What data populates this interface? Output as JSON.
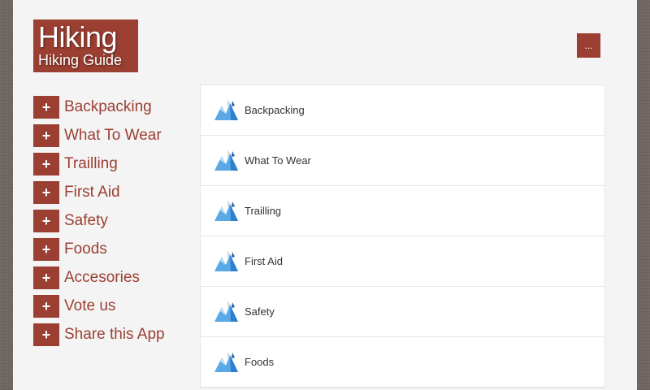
{
  "app": {
    "title": "Hiking",
    "subtitle": "Hiking Guide",
    "menu_label": "...",
    "accent": "#9b3f32"
  },
  "sidebar": {
    "items": [
      {
        "label": "Backpacking"
      },
      {
        "label": "What To Wear"
      },
      {
        "label": "Trailling"
      },
      {
        "label": "First Aid"
      },
      {
        "label": "Safety"
      },
      {
        "label": "Foods"
      },
      {
        "label": "Accesories"
      },
      {
        "label": "Vote us"
      },
      {
        "label": "Share this App"
      }
    ],
    "plus_symbol": "+"
  },
  "list": {
    "items": [
      {
        "label": "Backpacking",
        "icon": "mountain-icon"
      },
      {
        "label": "What To Wear",
        "icon": "mountain-icon"
      },
      {
        "label": "Trailling",
        "icon": "mountain-icon"
      },
      {
        "label": "First Aid",
        "icon": "mountain-icon"
      },
      {
        "label": "Safety",
        "icon": "mountain-icon"
      },
      {
        "label": "Foods",
        "icon": "mountain-icon"
      }
    ]
  }
}
